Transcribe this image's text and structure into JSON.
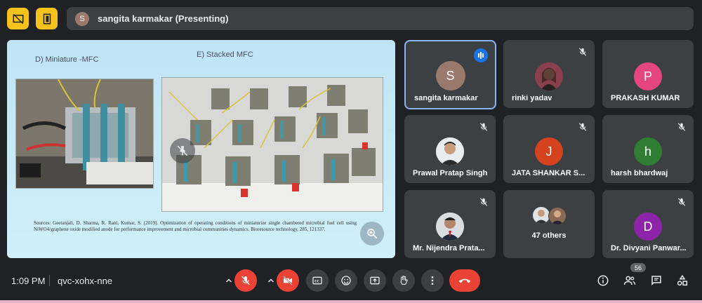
{
  "topbar": {
    "presenter_initial": "S",
    "presenter_text": "sangita karmakar (Presenting)"
  },
  "slide": {
    "label_left": "D) Miniature -MFC",
    "label_right": "E) Stacked MFC",
    "citation": "Sources: Geetanjali, D. Sharma, R. Rani, Kumar, S. (2019). Optimization of operating conditions of miniaturize single chambered microbial fuel cell using NiWO4/graphene oxide modified anode for performance improvement and microbial communities dynamics. Bioresource technology, 285, 121337."
  },
  "participants": [
    {
      "name": "sangita karmakar",
      "initial": "S",
      "color": "#9b7a6d",
      "state": "speaking"
    },
    {
      "name": "rinki yadav",
      "initial": "",
      "color": "#7a4b3a",
      "state": "muted"
    },
    {
      "name": "PRAKASH KUMAR",
      "initial": "P",
      "color": "#e5467f",
      "state": "none"
    },
    {
      "name": "Prawal Pratap Singh",
      "initial": "",
      "color": "#dfe3e6",
      "state": "muted"
    },
    {
      "name": "JATA SHANKAR S...",
      "initial": "J",
      "color": "#d4421e",
      "state": "muted"
    },
    {
      "name": "harsh bhardwaj",
      "initial": "h",
      "color": "#2f7d32",
      "state": "muted"
    },
    {
      "name": "Mr. Nijendra Prata...",
      "initial": "",
      "color": "#cfd8dc",
      "state": "muted"
    },
    {
      "name": "47 others",
      "initial": "",
      "color": "#3c4043",
      "state": "none"
    },
    {
      "name": "Dr. Divyani Panwar...",
      "initial": "D",
      "color": "#8e24aa",
      "state": "muted"
    }
  ],
  "bottombar": {
    "time": "1:09 PM",
    "meeting_code": "qvc-xohx-nne",
    "participant_count": "56"
  },
  "colors": {
    "accent_yellow": "#f6c21c",
    "red": "#ea4335",
    "blue": "#1a73e8",
    "tile_bg": "#3c4043",
    "bg": "#202124"
  }
}
